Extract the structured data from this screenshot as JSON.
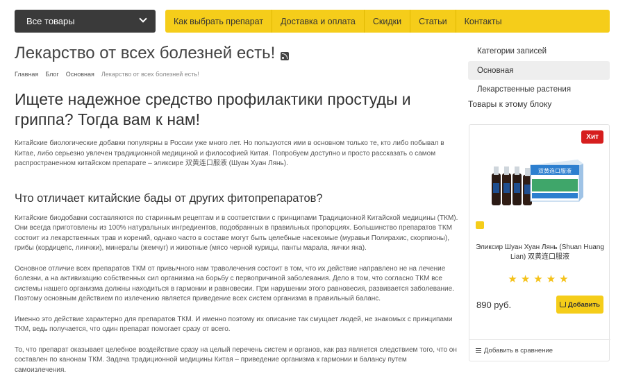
{
  "header": {
    "catalog_label": "Все товары",
    "nav": [
      "Как выбрать препарат",
      "Доставка и оплата",
      "Скидки",
      "Статьи",
      "Контакты"
    ]
  },
  "page": {
    "title": "Лекарство от всех болезней есть!",
    "breadcrumb": [
      "Главная",
      "Блог",
      "Основная",
      "Лекарство от всех болезней есть!"
    ]
  },
  "article": {
    "heading": "Ищете надежное средство профилактики простуды и гриппа? Тогда вам к нам!",
    "intro": "Китайские биологические добавки популярны в России уже много лет. Но пользуются ими в основном только те, кто либо побывал в Китае, либо серьезно увлечен традиционной медициной и философией Китая. Попробуем доступно и просто рассказать о самом распространенном китайском препарате – эликсире 双黄连口服液 (Шуан Хуан Лянь).",
    "subheading": "Что отличает китайские бады от других фитопрепаратов?",
    "p2": "Китайские биодобавки составляются по старинным рецептам и в соответствии с принципами Традиционной Китайской медицины (ТКМ). Они всегда приготовлены из 100% натуральных ингредиентов, подобранных в правильных пропорциях. Большинство препаратов ТКМ состоит из лекарственных трав и корений, однако часто в составе могут быть целебные насекомые (муравьи Полирахис, скорпионы), грибы (кордицепс, линчжи), минералы (жемчуг) и животные (мясо черной курицы, панты марала, яички яка).",
    "p3": "Основное отличие всех препаратов ТКМ от привычного нам траволечения состоит в том, что их действие направлено не на лечение болезни, а на активизацию собственных сил организма на борьбу с первопричиной заболевания. Дело в том, что согласно ТКМ все системы нашего организма должны находиться в гармонии и равновесии. При нарушении этого равновесия, развивается заболевание. Поэтому основным действием по излечению является приведение всех систем организма в правильный баланс.",
    "p4": "Именно это действие характерно для препаратов ТКМ. И именно поэтому их описание так смущает людей, не знакомых с принципами ТКМ, ведь получается, что один препарат помогает сразу от всего.",
    "p5": "То, что препарат оказывает целебное воздействие сразу на целый перечень систем и органов, как раз является следствием того, что он составлен по канонам ТКМ. Задача традиционной медицины Китая – приведение организма к гармонии и балансу путем самоизлечения."
  },
  "sidebar": {
    "categories_title": "Категории записей",
    "categories": [
      "Основная",
      "Лекарственные растения"
    ],
    "products_title": "Товары к этому блоку"
  },
  "product": {
    "badge": "Хит",
    "name": "Эликсир Шуан Хуан Лянь (Shuan Huang Lian) 双黄连口服液",
    "rating": 5,
    "stars": "★★★★★",
    "price": "890 руб.",
    "add_label": "Добавить",
    "compare_label": "Добавить в сравнение",
    "box_text": "双黄连口服液"
  },
  "colors": {
    "accent": "#f5cd1a",
    "dark": "#3a3a3a",
    "badge": "#d61e1e",
    "box_blue": "#2d7fcf"
  }
}
